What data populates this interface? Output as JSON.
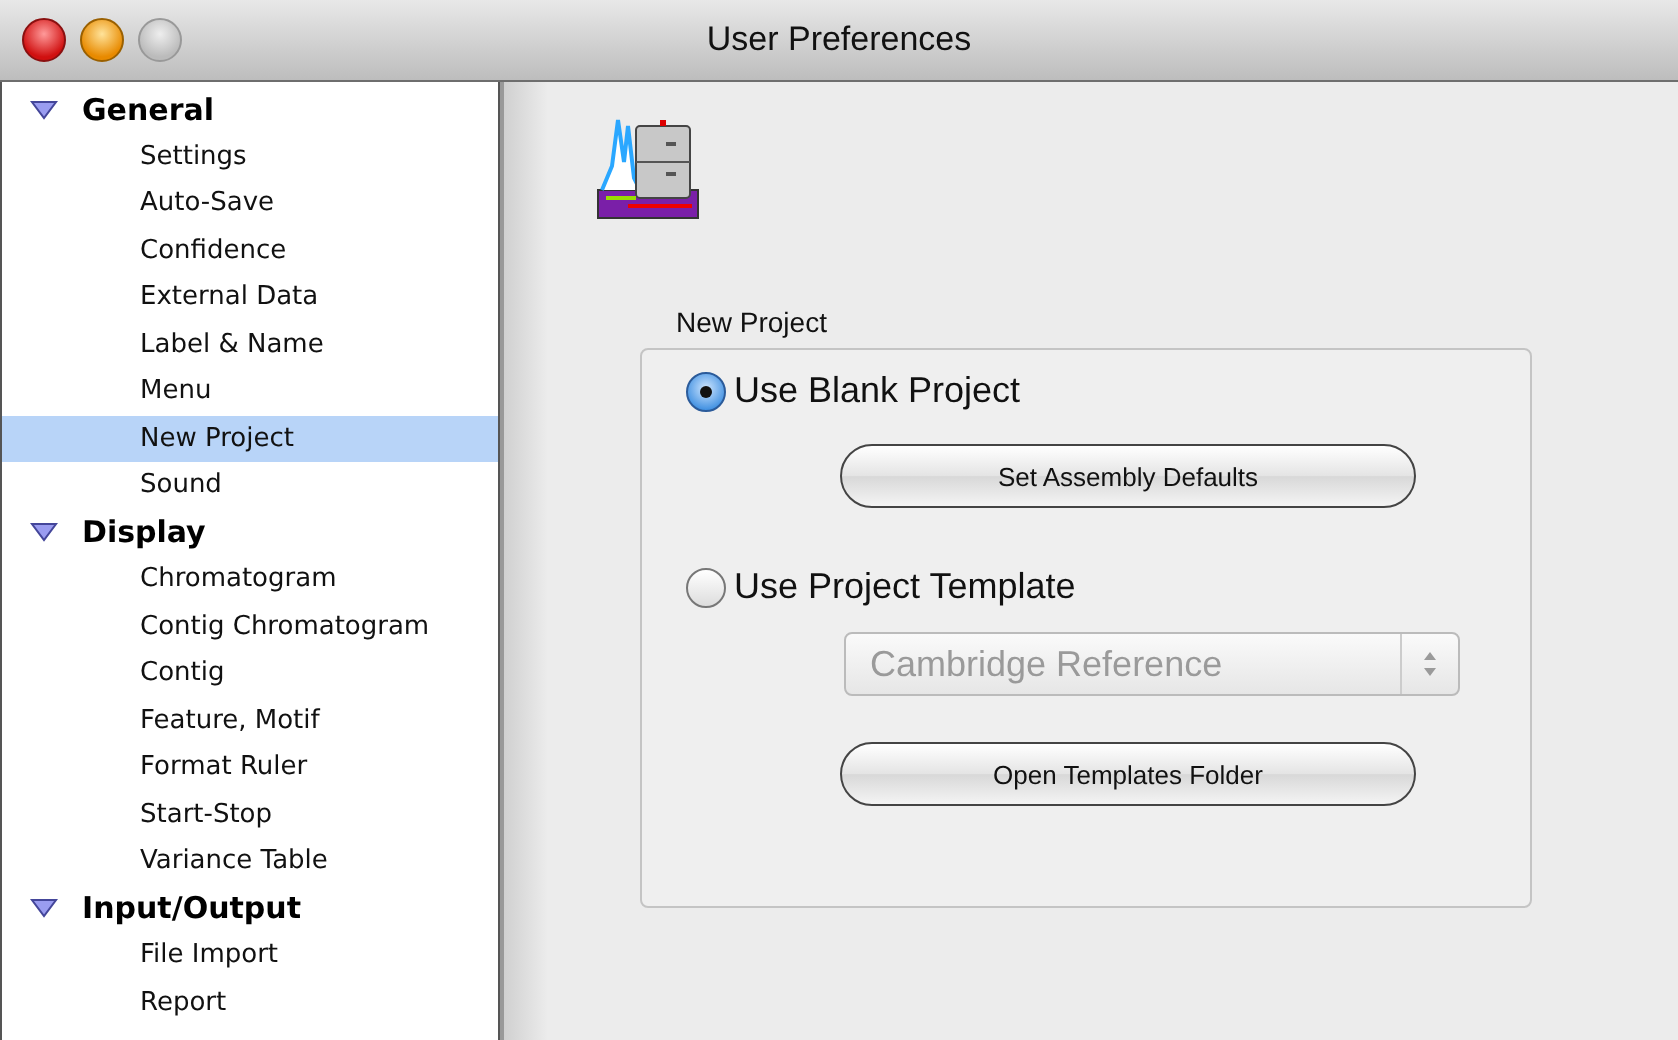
{
  "window": {
    "title": "User Preferences"
  },
  "sidebar": {
    "groups": [
      {
        "label": "General",
        "expanded": true,
        "children": [
          {
            "label": "Settings",
            "selected": false
          },
          {
            "label": "Auto-Save",
            "selected": false
          },
          {
            "label": "Confidence",
            "selected": false
          },
          {
            "label": "External Data",
            "selected": false
          },
          {
            "label": "Label & Name",
            "selected": false
          },
          {
            "label": "Menu",
            "selected": false
          },
          {
            "label": "New Project",
            "selected": true
          },
          {
            "label": "Sound",
            "selected": false
          }
        ]
      },
      {
        "label": "Display",
        "expanded": true,
        "children": [
          {
            "label": "Chromatogram",
            "selected": false
          },
          {
            "label": "Contig Chromatogram",
            "selected": false
          },
          {
            "label": "Contig",
            "selected": false
          },
          {
            "label": "Feature, Motif",
            "selected": false
          },
          {
            "label": "Format Ruler",
            "selected": false
          },
          {
            "label": "Start-Stop",
            "selected": false
          },
          {
            "label": "Variance Table",
            "selected": false
          }
        ]
      },
      {
        "label": "Input/Output",
        "expanded": true,
        "children": [
          {
            "label": "File Import",
            "selected": false
          },
          {
            "label": "Report",
            "selected": false
          }
        ]
      }
    ]
  },
  "panel": {
    "group_title": "New Project",
    "options": [
      {
        "kind": "radio",
        "label": "Use Blank Project",
        "selected": true
      },
      {
        "kind": "button",
        "label": "Set Assembly Defaults"
      },
      {
        "kind": "radio",
        "label": "Use Project Template",
        "selected": false
      },
      {
        "kind": "popup",
        "value": "Cambridge Reference",
        "disabled": true
      },
      {
        "kind": "button",
        "label": "Open Templates Folder"
      }
    ]
  }
}
